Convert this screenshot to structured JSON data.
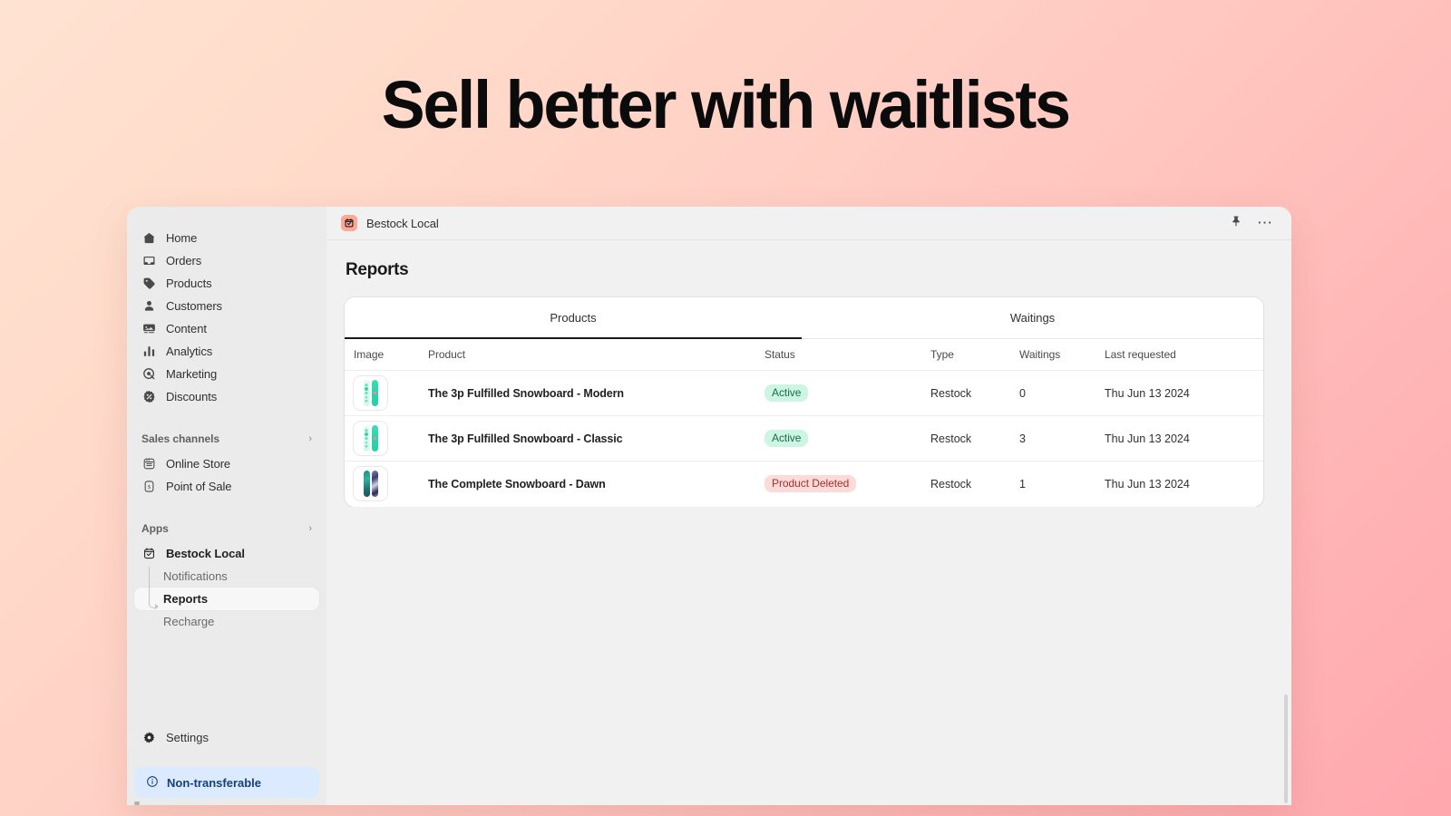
{
  "hero": {
    "title": "Sell better with waitlists"
  },
  "appbar": {
    "app_name": "Bestock Local",
    "app_icon": "bestock-app-icon",
    "pin_icon": "pin-icon",
    "more_icon": "ellipsis-icon"
  },
  "sidebar": {
    "nav": [
      {
        "label": "Home",
        "icon": "home-icon"
      },
      {
        "label": "Orders",
        "icon": "orders-inbox-icon"
      },
      {
        "label": "Products",
        "icon": "product-tag-icon"
      },
      {
        "label": "Customers",
        "icon": "customer-person-icon"
      },
      {
        "label": "Content",
        "icon": "content-image-icon"
      },
      {
        "label": "Analytics",
        "icon": "analytics-bars-icon"
      },
      {
        "label": "Marketing",
        "icon": "marketing-target-icon"
      },
      {
        "label": "Discounts",
        "icon": "discount-badge-icon"
      }
    ],
    "sales_channels": {
      "title": "Sales channels",
      "chevron": "chevron-right-icon",
      "items": [
        {
          "label": "Online Store",
          "icon": "online-store-icon"
        },
        {
          "label": "Point of Sale",
          "icon": "point-of-sale-icon"
        }
      ]
    },
    "apps": {
      "title": "Apps",
      "chevron": "chevron-right-icon",
      "app": {
        "label": "Bestock Local",
        "icon": "bestock-app-icon"
      },
      "items": [
        {
          "label": "Notifications",
          "active": false
        },
        {
          "label": "Reports",
          "active": true
        },
        {
          "label": "Recharge",
          "active": false
        }
      ]
    },
    "settings": {
      "label": "Settings",
      "icon": "gear-icon"
    },
    "banner": {
      "label": "Non-transferable",
      "icon": "info-circle-icon",
      "color": "#dbeafe"
    }
  },
  "main": {
    "page_title": "Reports",
    "tabs": [
      {
        "label": "Products",
        "active": true
      },
      {
        "label": "Waitings",
        "active": false
      }
    ],
    "table": {
      "columns": [
        "Image",
        "Product",
        "Status",
        "Type",
        "Waitings",
        "Last requested"
      ],
      "rows": [
        {
          "product": "The 3p Fulfilled Snowboard - Modern",
          "status": "Active",
          "status_tone": "green",
          "type": "Restock",
          "waitings": "0",
          "last_requested": "Thu Jun 13 2024",
          "thumb": "snowboard-modern-thumbnail"
        },
        {
          "product": "The 3p Fulfilled Snowboard - Classic",
          "status": "Active",
          "status_tone": "green",
          "type": "Restock",
          "waitings": "3",
          "last_requested": "Thu Jun 13 2024",
          "thumb": "snowboard-classic-thumbnail"
        },
        {
          "product": "The Complete Snowboard - Dawn",
          "status": "Product Deleted",
          "status_tone": "red",
          "type": "Restock",
          "waitings": "1",
          "last_requested": "Thu Jun 13 2024",
          "thumb": "snowboard-dawn-thumbnail"
        }
      ]
    }
  },
  "colors": {
    "accent_green_bg": "#cdf5e3",
    "accent_green_text": "#1d6a4b",
    "accent_red_bg": "#fcdbd9",
    "accent_red_text": "#a13130",
    "app_badge": "#ffa694",
    "banner_bg": "#dbeafe",
    "banner_text": "#17407a"
  }
}
